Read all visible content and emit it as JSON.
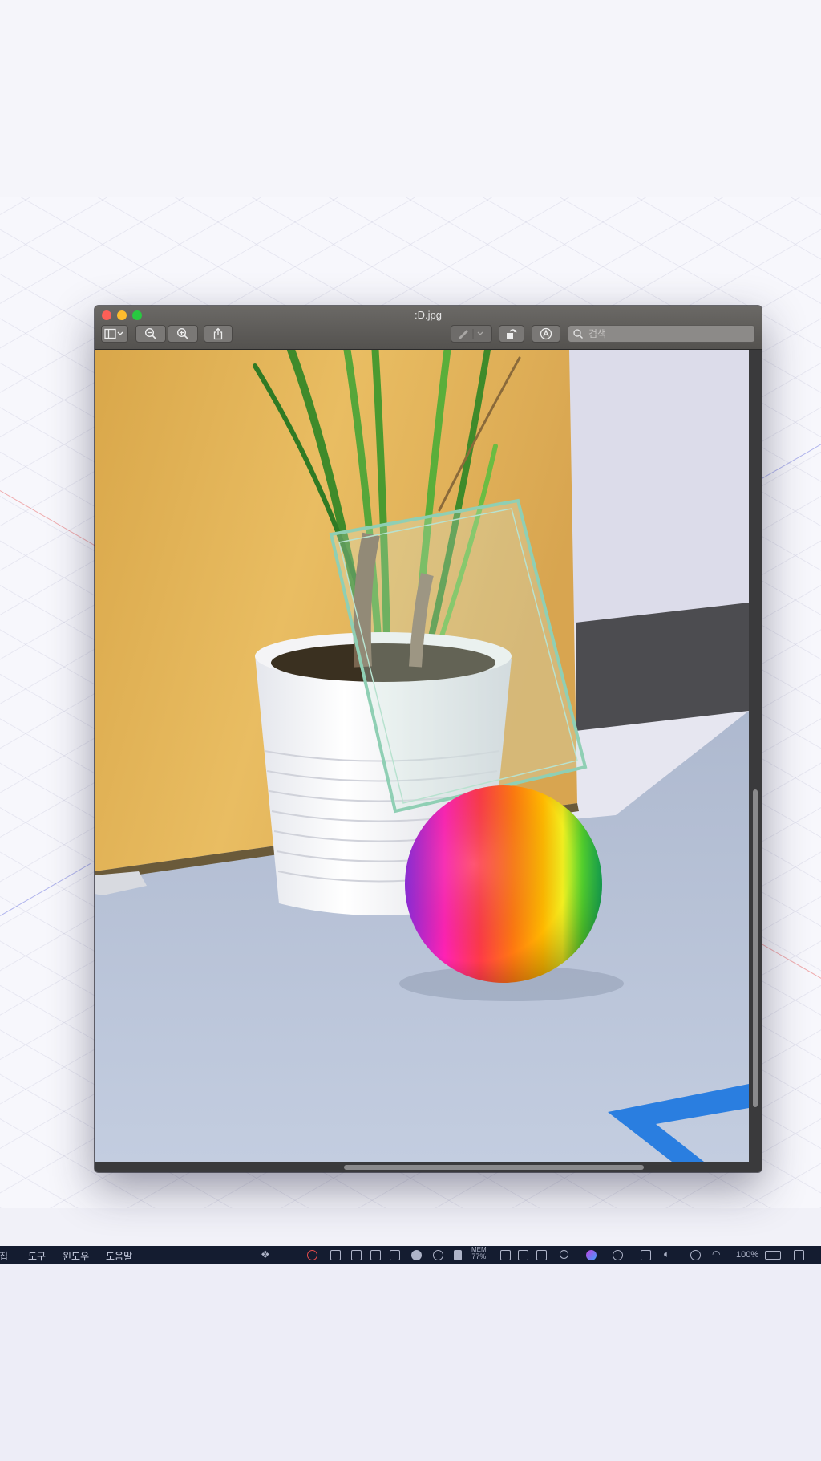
{
  "window": {
    "title": ":D.jpg",
    "toolbar": {
      "sidebar_icon": "sidebar-icon",
      "zoom_out_icon": "zoom-out-icon",
      "zoom_in_icon": "zoom-in-icon",
      "share_icon": "share-icon",
      "markup_icon": "pen-icon",
      "rotate_icon": "rotate-icon",
      "annotate_icon": "markup-a-icon",
      "search_placeholder": "검색"
    },
    "image_description_icon": "photo-plant-glass-rainbow-ball"
  },
  "menubar": {
    "items": [
      "편집",
      "도구",
      "윈도우",
      "도움말"
    ],
    "status": {
      "mem_label": "MEM",
      "mem_value": "77%",
      "battery": "100%"
    }
  },
  "colors": {
    "titlebar": "#5f5d5a",
    "menubar": "#141c30",
    "close": "#fc5f57",
    "minimize": "#fdbc2e",
    "zoom": "#28c840"
  }
}
